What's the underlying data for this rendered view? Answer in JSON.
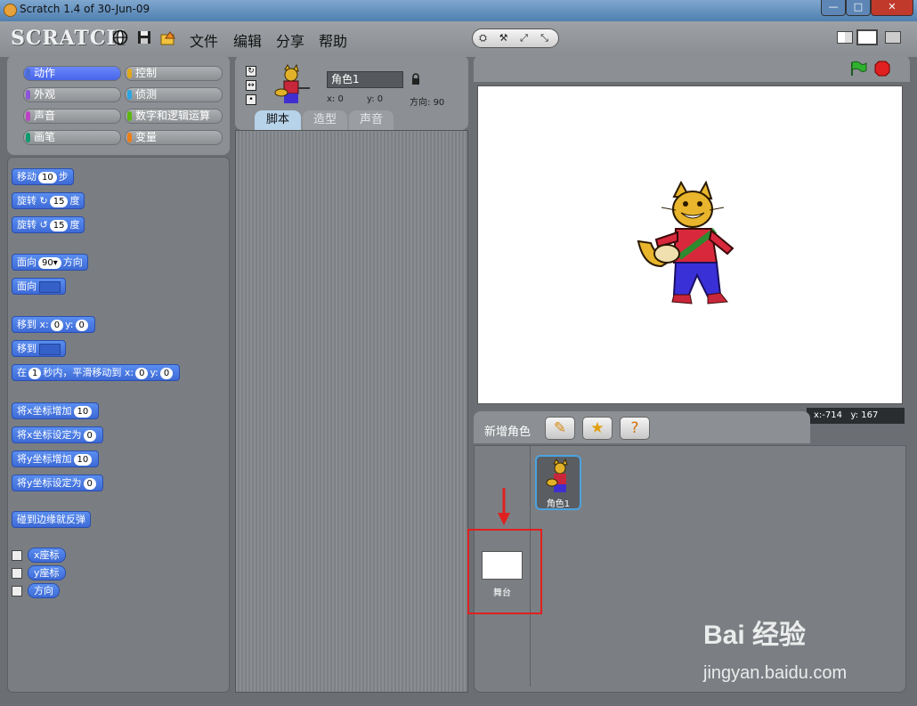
{
  "window": {
    "title": "Scratch 1.4 of 30-Jun-09"
  },
  "menubar": {
    "logo": "SCRATCH",
    "menus": [
      "文件",
      "编辑",
      "分享",
      "帮助"
    ],
    "mode_buttons": [
      "⛭",
      "⚒",
      "⤢",
      "⤡"
    ]
  },
  "categories": [
    {
      "label": "动作",
      "color": "#4a6cd4",
      "selected": true
    },
    {
      "label": "控制",
      "color": "#e1a91a"
    },
    {
      "label": "外观",
      "color": "#8a55d7"
    },
    {
      "label": "侦测",
      "color": "#2ca5e2"
    },
    {
      "label": "声音",
      "color": "#bb42c3"
    },
    {
      "label": "数字和逻辑运算",
      "color": "#5cb712"
    },
    {
      "label": "画笔",
      "color": "#0e9a6c"
    },
    {
      "label": "变量",
      "color": "#ee7d16"
    }
  ],
  "blocks": {
    "move": {
      "pre": "移动",
      "num": "10",
      "post": "步"
    },
    "turn_r": {
      "pre": "旋转",
      "icon": "↻",
      "num": "15",
      "post": "度"
    },
    "turn_l": {
      "pre": "旋转",
      "icon": "↺",
      "num": "15",
      "post": "度"
    },
    "point_dir": {
      "pre": "面向",
      "num": "90▾",
      "post": "方向"
    },
    "point_towards": {
      "pre": "面向"
    },
    "goto_xy": {
      "pre": "移到",
      "xl": "x:",
      "x": "0",
      "yl": "y:",
      "y": "0"
    },
    "goto": {
      "pre": "移到"
    },
    "glide": {
      "pre": "在",
      "num": "1",
      "mid": "秒内，平滑移动到",
      "xl": "x:",
      "x": "0",
      "yl": "y:",
      "y": "0"
    },
    "change_x": {
      "pre": "将x坐标增加",
      "num": "10"
    },
    "set_x": {
      "pre": "将x坐标设定为",
      "num": "0"
    },
    "change_y": {
      "pre": "将y坐标增加",
      "num": "10"
    },
    "set_y": {
      "pre": "将y坐标设定为",
      "num": "0"
    },
    "bounce": {
      "pre": "碰到边缘就反弹"
    },
    "rep_x": "x座标",
    "rep_y": "y座标",
    "rep_dir": "方向"
  },
  "sprite": {
    "name": "角色1",
    "x_label": "x:",
    "x": "0",
    "y_label": "y:",
    "y": "0",
    "dir_label": "方向:",
    "dir": "90"
  },
  "tabs": [
    "脚本",
    "造型",
    "声音"
  ],
  "stage": {
    "mouse_x_label": "x:",
    "mouse_x": "-714",
    "mouse_y_label": "y:",
    "mouse_y": "167"
  },
  "sprite_list": {
    "new_sprite": "新增角色",
    "sprite_label": "角色1",
    "stage_label": "舞台"
  },
  "watermark": {
    "brand": "Bai 经验",
    "url": "jingyan.baidu.com"
  }
}
